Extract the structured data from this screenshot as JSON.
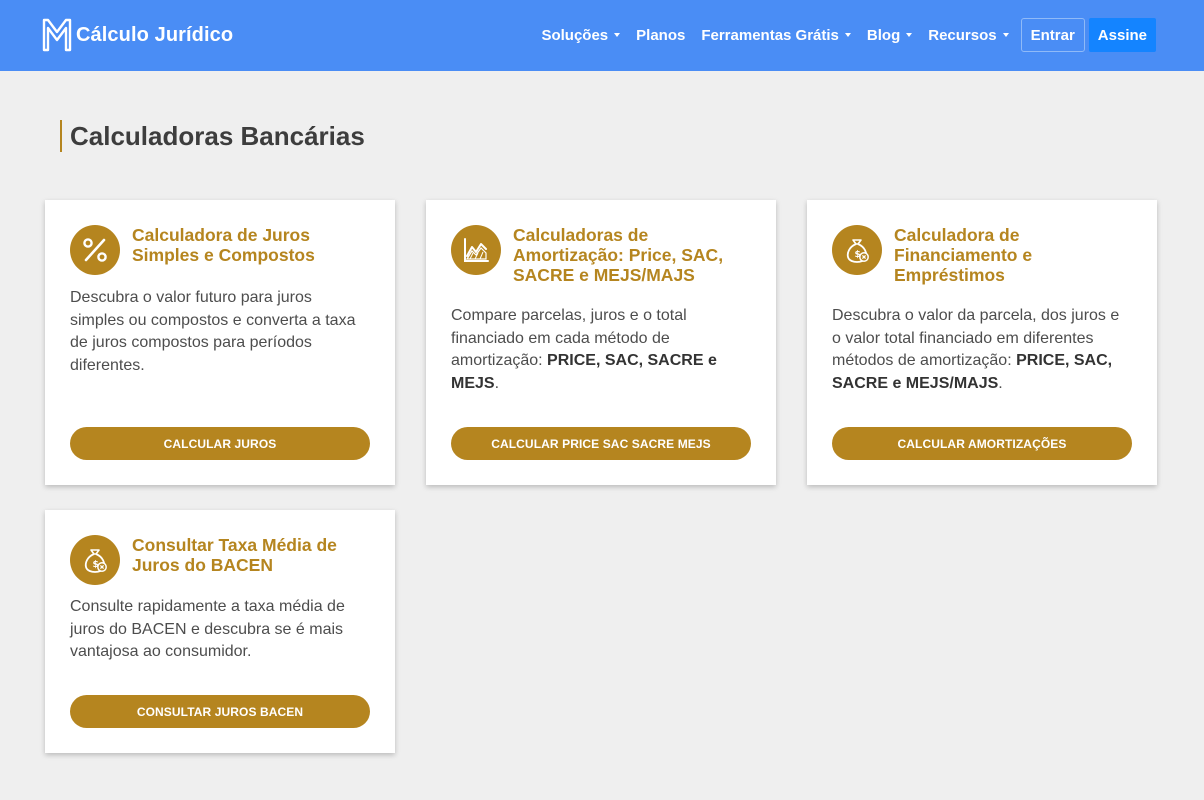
{
  "brand": {
    "name": "Cálculo Jurídico"
  },
  "nav": {
    "items": [
      {
        "label": "Soluções",
        "dropdown": true
      },
      {
        "label": "Planos",
        "dropdown": false
      },
      {
        "label": "Ferramentas Grátis",
        "dropdown": true
      },
      {
        "label": "Blog",
        "dropdown": true
      },
      {
        "label": "Recursos",
        "dropdown": true
      }
    ],
    "login_label": "Entrar",
    "signup_label": "Assine"
  },
  "page": {
    "title": "Calculadoras Bancárias"
  },
  "cards": [
    {
      "icon": "percent-icon",
      "title": "Calculadora de Juros Simples e Compostos",
      "desc_parts": [
        {
          "text": "Descubra o valor futuro para juros simples ou compostos e converta a taxa de juros compostos para períodos diferentes.",
          "bold": false
        }
      ],
      "button": "CALCULAR JUROS"
    },
    {
      "icon": "chart-icon",
      "title": "Calculadoras de Amortização: Price, SAC, SACRE e MEJS/MAJS",
      "desc_parts": [
        {
          "text": "Compare parcelas, juros e o total financiado em cada método de amortização: ",
          "bold": false
        },
        {
          "text": "PRICE, SAC, SACRE e MEJS",
          "bold": true
        },
        {
          "text": ".",
          "bold": false
        }
      ],
      "button": "CALCULAR PRICE SAC SACRE MEJS"
    },
    {
      "icon": "money-bag-icon",
      "title": "Calculadora de Financiamento e Empréstimos",
      "desc_parts": [
        {
          "text": "Descubra o valor da parcela, dos juros e o valor total financiado em diferentes métodos de amortização: ",
          "bold": false
        },
        {
          "text": "PRICE, SAC, SACRE e MEJS/MAJS",
          "bold": true
        },
        {
          "text": ".",
          "bold": false
        }
      ],
      "button": "CALCULAR AMORTIZAÇÕES"
    },
    {
      "icon": "money-bag-icon",
      "title": "Consultar Taxa Média de Juros do BACEN",
      "desc_parts": [
        {
          "text": "Consulte rapidamente a taxa média de juros do BACEN e descubra se é mais vantajosa ao consumidor.",
          "bold": false
        }
      ],
      "button": "CONSULTAR JUROS BACEN"
    }
  ],
  "colors": {
    "navbar": "#4a8df5",
    "accent_gold": "#b5851f",
    "signup_button": "#1484ff",
    "page_bg": "#efefef"
  }
}
